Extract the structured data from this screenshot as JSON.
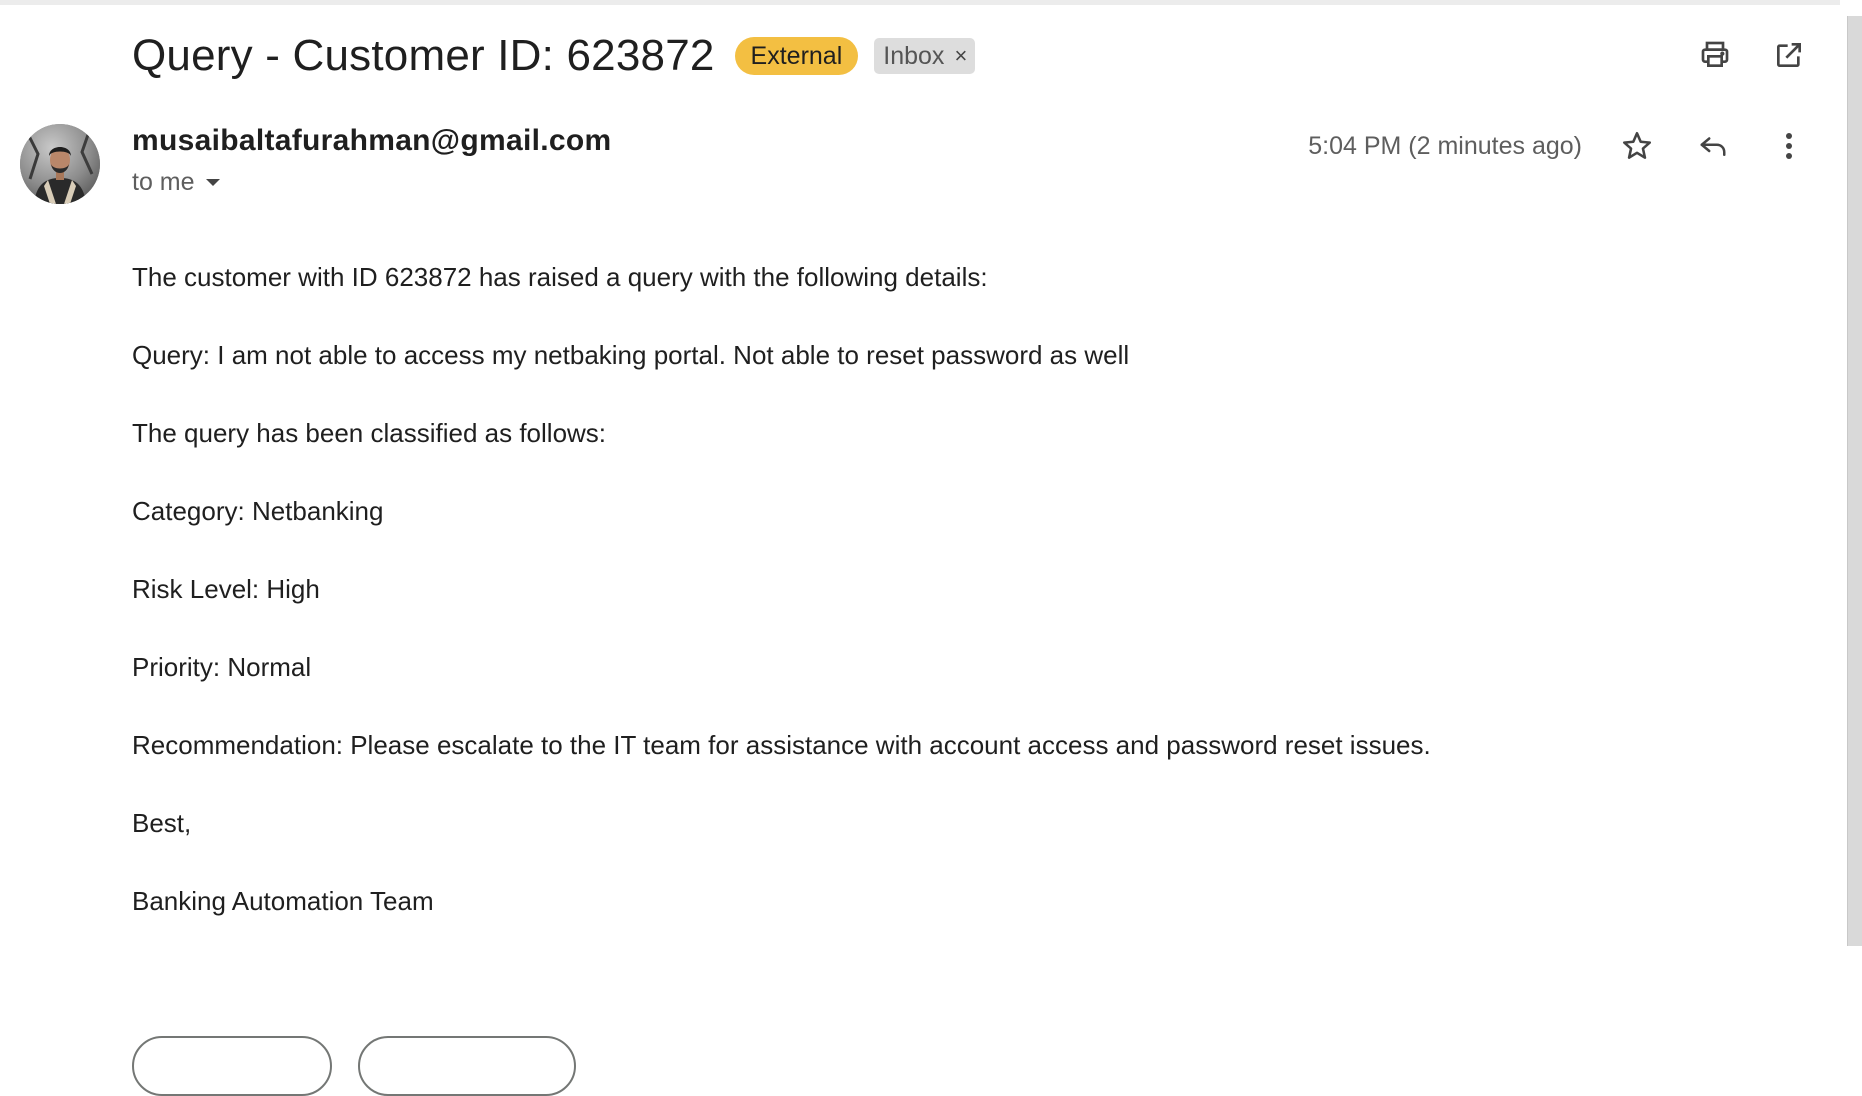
{
  "email": {
    "subject": "Query - Customer ID: 623872",
    "labels": {
      "external": "External",
      "inbox": "Inbox",
      "inbox_remove": "×"
    },
    "sender": {
      "email": "musaibaltafurahman@gmail.com",
      "recipient": "to me"
    },
    "timestamp": "5:04 PM (2 minutes ago)",
    "body": [
      "The customer with ID 623872 has raised a query with the following details:",
      "Query: I am not able to access my netbaking portal. Not able to reset password as well",
      "The query has been classified as follows:",
      "Category: Netbanking",
      "Risk Level: High",
      "Priority: Normal",
      "Recommendation: Please escalate to the IT team for assistance with account access and password reset issues.",
      "Best,",
      "Banking Automation Team"
    ]
  },
  "icons": {
    "print": "print-icon",
    "open_new_window": "open-in-new-window-icon",
    "star": "star-icon",
    "reply": "reply-icon",
    "more": "more-vertical-icon",
    "dropdown": "chevron-down-icon"
  },
  "colors": {
    "external_badge": "#f3bf42",
    "inbox_badge": "#dddddd",
    "text_primary": "#1f1f1f",
    "text_secondary": "#5e5e5e"
  }
}
